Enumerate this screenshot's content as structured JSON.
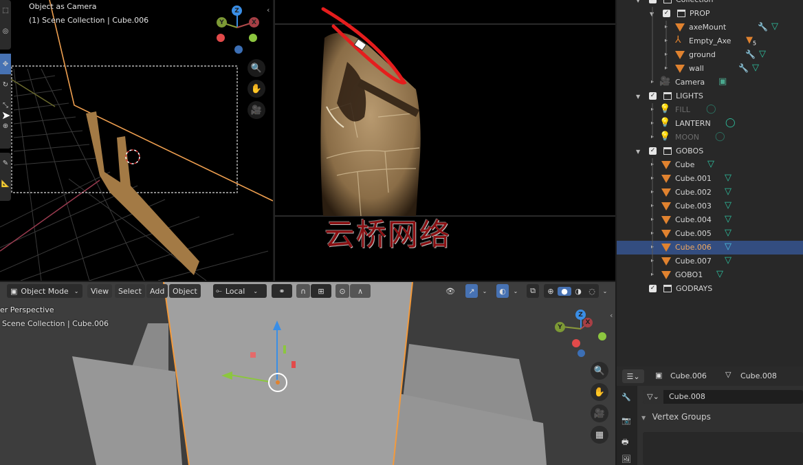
{
  "viewport_top_left": {
    "view_name": "Object as Camera",
    "context": "(1) Scene Collection | Cube.006",
    "toolbar_tools": [
      "select-box-icon",
      "cursor-icon",
      "move-icon",
      "rotate-icon",
      "scale-icon",
      "transform-icon",
      "annotate-icon",
      "measure-icon"
    ],
    "gizmo": {
      "z": "Z",
      "y": "Y",
      "x": "X"
    },
    "nav_buttons": [
      "zoom-icon",
      "hand-icon",
      "camera-icon"
    ]
  },
  "viewport_camera": {
    "description": "Rendered camera view of axe on stone wall"
  },
  "watermark": "云桥网络",
  "viewport_bottom": {
    "header": {
      "mode": "Object Mode",
      "menus": [
        "View",
        "Select",
        "Add",
        "Object"
      ],
      "transform_orientation": "Local",
      "pivot_icon": "link-icon",
      "snap_icon": "magnet-icon",
      "proportional_icon": "proportional-icon"
    },
    "view_name": "User Perspective",
    "view_name_visible": "er Perspective",
    "context": "Scene Collection | Cube.006",
    "gizmo": {
      "z": "Z",
      "y": "Y",
      "x": "X"
    },
    "nav_buttons": [
      "zoom-icon",
      "hand-icon",
      "camera-icon",
      "grid-icon"
    ]
  },
  "outliner": {
    "rows": [
      {
        "label": "Collection",
        "type": "collection",
        "depth": 0
      },
      {
        "label": "PROP",
        "type": "collection",
        "depth": 1
      },
      {
        "label": "axeMount",
        "type": "mesh",
        "depth": 2,
        "modifier": true,
        "data": true
      },
      {
        "label": "Empty_Axe",
        "type": "empty",
        "depth": 2,
        "children_badge": "5"
      },
      {
        "label": "ground",
        "type": "mesh",
        "depth": 2,
        "modifier": true,
        "data": true
      },
      {
        "label": "wall",
        "type": "mesh",
        "depth": 2,
        "modifier": true,
        "data": true
      },
      {
        "label": "Camera",
        "type": "camera",
        "depth": 1
      },
      {
        "label": "LIGHTS",
        "type": "collection",
        "depth": 0
      },
      {
        "label": "FILL",
        "type": "light",
        "depth": 1,
        "dim": true
      },
      {
        "label": "LANTERN",
        "type": "light",
        "depth": 1
      },
      {
        "label": "MOON",
        "type": "light",
        "depth": 1,
        "dim": true
      },
      {
        "label": "GOBOS",
        "type": "collection",
        "depth": 0
      },
      {
        "label": "Cube",
        "type": "mesh",
        "depth": 1
      },
      {
        "label": "Cube.001",
        "type": "mesh",
        "depth": 1
      },
      {
        "label": "Cube.002",
        "type": "mesh",
        "depth": 1
      },
      {
        "label": "Cube.003",
        "type": "mesh",
        "depth": 1
      },
      {
        "label": "Cube.004",
        "type": "mesh",
        "depth": 1
      },
      {
        "label": "Cube.005",
        "type": "mesh",
        "depth": 1
      },
      {
        "label": "Cube.006",
        "type": "mesh",
        "depth": 1,
        "selected": true
      },
      {
        "label": "Cube.007",
        "type": "mesh",
        "depth": 1
      },
      {
        "label": "GOBO1",
        "type": "mesh",
        "depth": 1
      },
      {
        "label": "GODRAYS",
        "type": "collection",
        "depth": 0
      }
    ]
  },
  "properties": {
    "object_name": "Cube.006",
    "mesh_name": "Cube.008",
    "datablock_field": "Cube.008",
    "panel_title": "Vertex Groups",
    "tabs": [
      "tool-icon",
      "render-icon",
      "output-icon",
      "view-layer-icon"
    ]
  },
  "colors": {
    "selection": "#334d80",
    "active_button": "#4772b3",
    "object_orange": "#e0822f",
    "data_teal": "#2ec2a0",
    "axis_x": "#e24a4a",
    "axis_y": "#8cc63f",
    "axis_z": "#3a8ee6"
  }
}
